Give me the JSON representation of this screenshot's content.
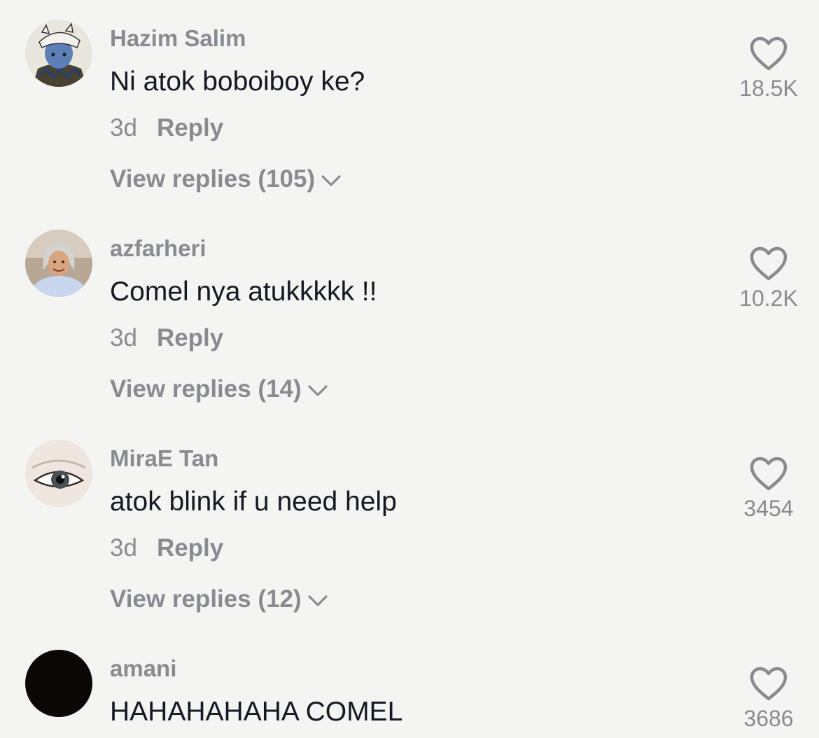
{
  "comments": [
    {
      "username": "Hazim Salim",
      "text": "Ni atok boboiboy ke?",
      "time": "3d",
      "reply_label": "Reply",
      "view_replies": "View replies (105)",
      "likes": "18.5K",
      "avatar_icon": "anime-character-avatar-icon"
    },
    {
      "username": "azfarheri",
      "text": "Comel nya atukkkkk !!",
      "time": "3d",
      "reply_label": "Reply",
      "view_replies": "View replies (14)",
      "likes": "10.2K",
      "avatar_icon": "person-photo-avatar-icon"
    },
    {
      "username": "MiraE Tan",
      "text": "atok blink if u need help",
      "time": "3d",
      "reply_label": "Reply",
      "view_replies": "View replies (12)",
      "likes": "3454",
      "avatar_icon": "eye-closeup-avatar-icon"
    },
    {
      "username": "amani",
      "text": "HAHAHAHAHA COMEL",
      "likes": "3686",
      "avatar_icon": "dark-avatar-icon"
    }
  ],
  "colors": {
    "background": "#f4f4f3",
    "text_primary": "#161823",
    "text_secondary": "#8a8b91"
  }
}
